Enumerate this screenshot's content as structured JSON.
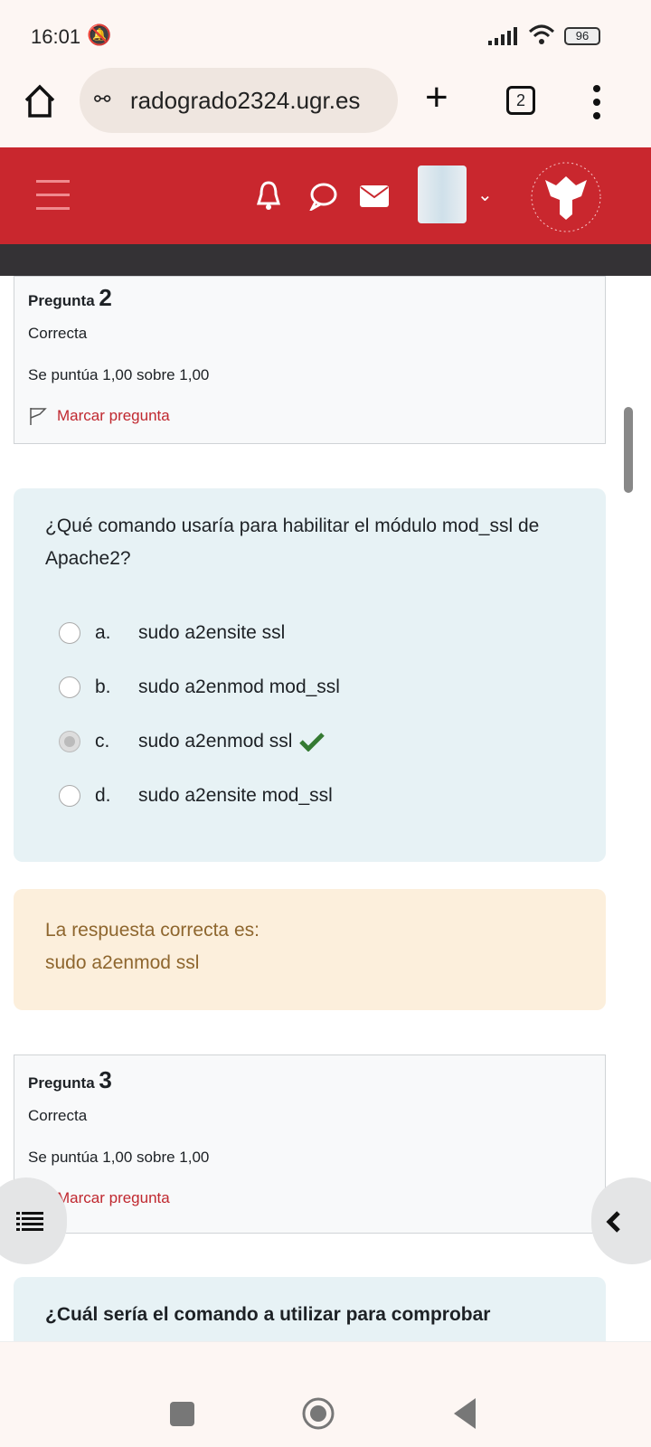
{
  "status": {
    "time": "16:01",
    "battery": "96"
  },
  "browser": {
    "url": "radogrado2324.ugr.es",
    "tab_count": "2"
  },
  "questions": [
    {
      "label": "Pregunta",
      "number": "2",
      "state": "Correcta",
      "grade": "Se puntúa 1,00 sobre 1,00",
      "flag": "Marcar pregunta",
      "text": "¿Qué comando usaría para habilitar el módulo mod_ssl de Apache2?",
      "options": [
        {
          "letter": "a.",
          "text": "sudo a2ensite ssl"
        },
        {
          "letter": "b.",
          "text": "sudo a2enmod mod_ssl"
        },
        {
          "letter": "c.",
          "text": "sudo a2enmod ssl",
          "selected": true,
          "correct": true
        },
        {
          "letter": "d.",
          "text": "sudo a2ensite mod_ssl"
        }
      ],
      "feedback_label": "La respuesta correcta es:",
      "feedback_answer": "sudo a2enmod ssl"
    },
    {
      "label": "Pregunta",
      "number": "3",
      "state": "Correcta",
      "grade": "Se puntúa 1,00 sobre 1,00",
      "flag": "Marcar pregunta",
      "text": "¿Cuál sería el comando a utilizar para comprobar"
    }
  ],
  "colors": {
    "brand": "#c9272e",
    "correct": "#357a32",
    "flag": "#c0282f"
  }
}
